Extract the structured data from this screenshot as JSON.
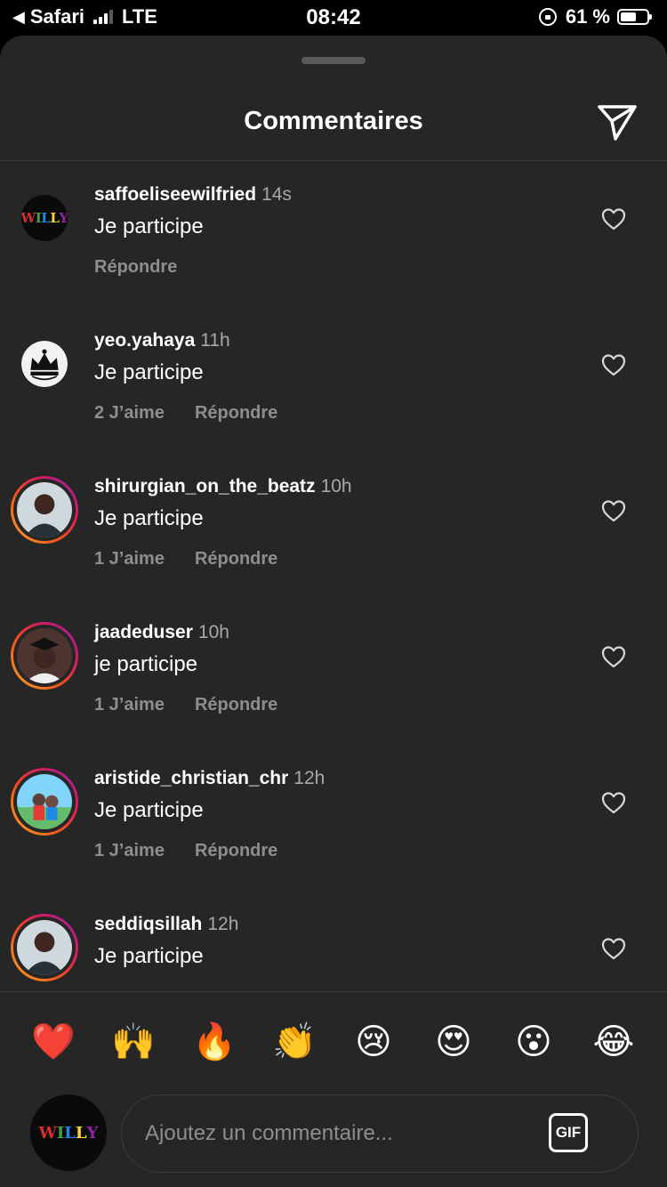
{
  "status_bar": {
    "back_app": "Safari",
    "network": "LTE",
    "time": "08:42",
    "battery": "61 %",
    "battery_level": 0.61
  },
  "header": {
    "title": "Commentaires"
  },
  "comments": [
    {
      "username": "saffoeliseewilfried",
      "time": "14s",
      "text": "Je participe",
      "likes": "",
      "reply": "Répondre",
      "avatar": "willy-logo",
      "story_ring": false
    },
    {
      "username": "yeo.yahaya",
      "time": "11h",
      "text": "Je participe",
      "likes": "2 J’aime",
      "reply": "Répondre",
      "avatar": "crown-logo",
      "story_ring": false
    },
    {
      "username": "shirurgian_on_the_beatz",
      "time": "10h",
      "text": "Je participe",
      "likes": "1 J’aime",
      "reply": "Répondre",
      "avatar": "person-photo",
      "story_ring": true
    },
    {
      "username": "jaadeduser",
      "time": "10h",
      "text": "je participe",
      "likes": "1 J’aime",
      "reply": "Répondre",
      "avatar": "graduate-photo",
      "story_ring": true
    },
    {
      "username": "aristide_christian_chr",
      "time": "12h",
      "text": "Je participe",
      "likes": "1 J’aime",
      "reply": "Répondre",
      "avatar": "outdoor-photo",
      "story_ring": true
    },
    {
      "username": "seddiqsillah",
      "time": "12h",
      "text": "Je participe",
      "likes": "",
      "reply": "",
      "avatar": "person-photo",
      "story_ring": true
    }
  ],
  "avatar_logo": {
    "letters": [
      "W",
      "I",
      "L",
      "L",
      "Y"
    ]
  },
  "emoji_bar": [
    "❤️",
    "🙌",
    "🔥",
    "👏",
    "😢",
    "😍",
    "😮",
    "😂"
  ],
  "composer": {
    "placeholder": "Ajoutez un commentaire...",
    "gif_label": "GIF"
  },
  "colors": {
    "sheet_bg": "#262626",
    "muted": "#a8a8a8",
    "action": "#8e8e8e"
  }
}
